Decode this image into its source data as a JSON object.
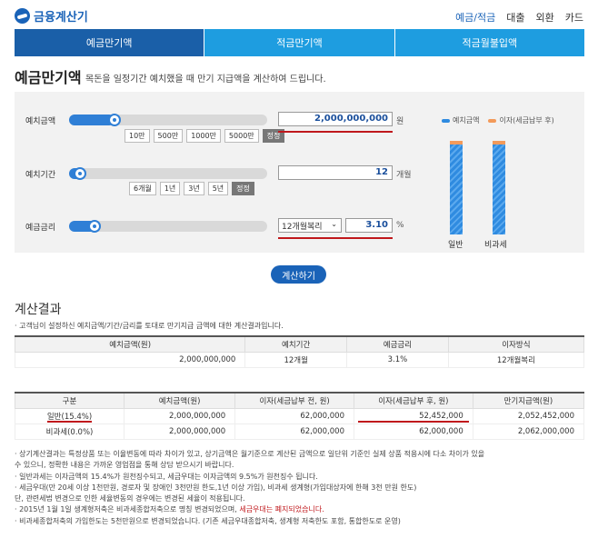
{
  "header": {
    "logo_text": "금융계산기",
    "nav": [
      "예금/적금",
      "대출",
      "외환",
      "카드"
    ]
  },
  "tabs": [
    "예금만기액",
    "적금만기액",
    "적금월불입액"
  ],
  "page": {
    "title": "예금만기액",
    "desc": "목돈을 일정기간 예치했을 때 만기 지급액을 계산하여 드립니다."
  },
  "form": {
    "deposit": {
      "label": "예치금액",
      "value": "2,000,000,000",
      "unit": "원",
      "slider_fraction": 0.23,
      "chips": [
        "10만",
        "500만",
        "1000만",
        "5000만",
        "정정"
      ]
    },
    "period": {
      "label": "예치기간",
      "value": "12",
      "unit": "개월",
      "slider_fraction": 0.05,
      "chips": [
        "6개월",
        "1년",
        "3년",
        "5년",
        "정정"
      ]
    },
    "rate": {
      "label": "예금금리",
      "value": "3.10",
      "unit": "%",
      "slider_fraction": 0.15,
      "select": "12개월복리"
    }
  },
  "chart_data": {
    "type": "bar",
    "categories": [
      "일반",
      "비과세"
    ],
    "series": [
      {
        "name": "예치금액",
        "values": [
          2000000000,
          2000000000
        ]
      },
      {
        "name": "이자(세금납부 후)",
        "values": [
          52452000,
          62000000
        ]
      }
    ],
    "colors": {
      "principal": "#2f8be0",
      "interest": "#f39a5a"
    }
  },
  "calc_button": "계산하기",
  "result": {
    "title": "계산결과",
    "note": "· 고객님이 설정하신 예치금액/기간/금리를 토대로 만기지급 금액에 대한 계산결과입니다.",
    "table1": {
      "headers": [
        "예치금액(원)",
        "예치기간",
        "예금금리",
        "이자방식"
      ],
      "row": [
        "2,000,000,000",
        "12개월",
        "3.1%",
        "12개월복리"
      ]
    },
    "table2": {
      "headers": [
        "구분",
        "예치금액(원)",
        "이자(세금납부 전, 원)",
        "이자(세금납부 후, 원)",
        "만기지급액(원)"
      ],
      "rows": [
        [
          "일반(15.4%)",
          "2,000,000,000",
          "62,000,000",
          "52,452,000",
          "2,052,452,000"
        ],
        [
          "비과세(0.0%)",
          "2,000,000,000",
          "62,000,000",
          "62,000,000",
          "2,062,000,000"
        ]
      ]
    }
  },
  "notes": [
    "· 상기계산결과는 특정상품 또는 이율변동에 따라 차이가 있고, 상기금액은 월기준으로 계산된 금액으로 일단위 기준인 실제 상품 적용시에 다소 차이가 있을",
    "  수 있으니, 정확한 내용은 가까운 영업점을 통해 상담 받으시기 바랍니다.",
    "· 일반과세는 이자금액의 15.4%가 원천징수되고, 세금우대는 이자금액의 9.5%가 원천징수 됩니다.",
    "· 세금우대(만 20세 이상 1천만원, 경로자 및 장애인 3천만원 한도,1년 이상 가입), 비과세 생계형(가입대상자에 한해 3천 만원 한도)",
    "  단, 관련세법 변경으로 인한 세율변동의 경우에는 변경된 세율이 적용됩니다.",
    "· 2015년 1월 1일 생계형저축은 비과세종합저축으로 명칭 변경되었으며, ",
    "· 비과세종합저축의 가입한도는 5천만원으로 변경되었습니다. (기존 세금우대종합저축, 생계형 저축한도 포함, 통합한도로 운영)"
  ],
  "notes_highlight": "세금우대는 폐지되었습니다."
}
